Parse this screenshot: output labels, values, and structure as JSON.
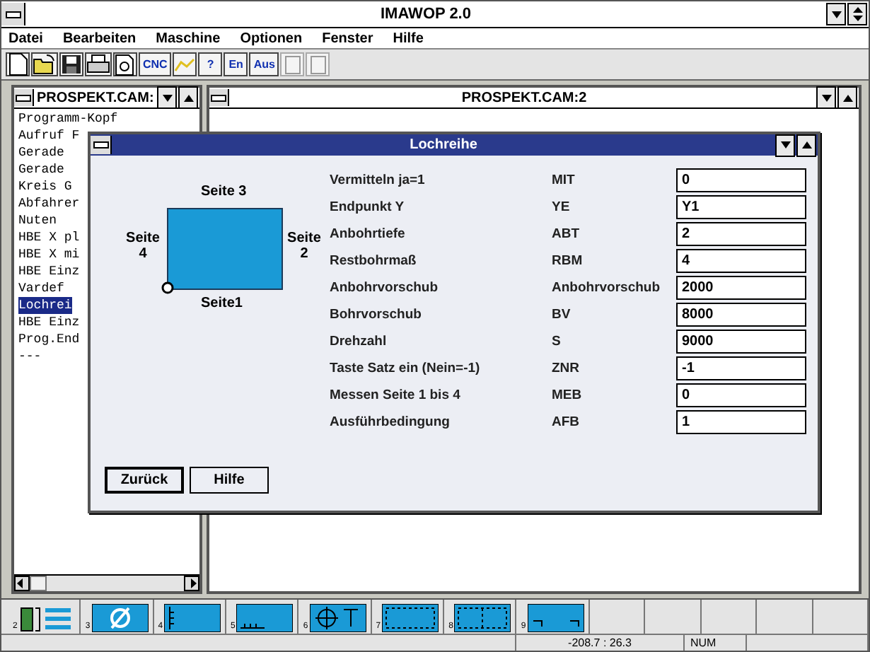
{
  "window": {
    "title": "IMAWOP 2.0"
  },
  "menu": [
    "Datei",
    "Bearbeiten",
    "Maschine",
    "Optionen",
    "Fenster",
    "Hilfe"
  ],
  "toolbar": [
    {
      "kind": "new"
    },
    {
      "kind": "open"
    },
    {
      "kind": "save"
    },
    {
      "kind": "print"
    },
    {
      "kind": "preview"
    },
    {
      "kind": "text",
      "label": "CNC"
    },
    {
      "kind": "chart"
    },
    {
      "kind": "text",
      "label": "?"
    },
    {
      "kind": "text",
      "label": "En"
    },
    {
      "kind": "text",
      "label": "Aus"
    },
    {
      "kind": "disabled"
    },
    {
      "kind": "disabled"
    }
  ],
  "left_window": {
    "title": "PROSPEKT.CAM:",
    "items": [
      {
        "text": "Programm-Kopf",
        "selected": false
      },
      {
        "text": "Aufruf F",
        "selected": false
      },
      {
        "text": "Gerade",
        "selected": false
      },
      {
        "text": "Gerade",
        "selected": false
      },
      {
        "text": "Kreis G",
        "selected": false
      },
      {
        "text": "Abfahrer",
        "selected": false
      },
      {
        "text": "Nuten",
        "selected": false
      },
      {
        "text": "HBE X pl",
        "selected": false
      },
      {
        "text": "HBE X mi",
        "selected": false
      },
      {
        "text": "HBE Einz",
        "selected": false
      },
      {
        "text": "Vardef",
        "selected": false
      },
      {
        "text": "Lochrei",
        "selected": true
      },
      {
        "text": "HBE Einz",
        "selected": false
      },
      {
        "text": "Prog.End",
        "selected": false
      },
      {
        "text": "---",
        "selected": false
      }
    ]
  },
  "right_window": {
    "title": "PROSPEKT.CAM:2"
  },
  "dialog": {
    "title": "Lochreihe",
    "diagram": {
      "top": "Seite 3",
      "left": "Seite 4",
      "right": "Seite 2",
      "bottom": "Seite1"
    },
    "fields": [
      {
        "label": "Vermitteln ja=1",
        "code": "MIT",
        "value": "0"
      },
      {
        "label": "Endpunkt Y",
        "code": "YE",
        "value": "Y1"
      },
      {
        "label": "Anbohrtiefe",
        "code": "ABT",
        "value": "2"
      },
      {
        "label": "Restbohrmaß",
        "code": "RBM",
        "value": "4"
      },
      {
        "label": "Anbohrvorschub",
        "code": "Anbohrvorschub",
        "value": "2000"
      },
      {
        "label": "Bohrvorschub",
        "code": "BV",
        "value": "8000"
      },
      {
        "label": "Drehzahl",
        "code": "S",
        "value": "9000"
      },
      {
        "label": "Taste Satz ein (Nein=-1)",
        "code": "ZNR",
        "value": "-1"
      },
      {
        "label": "Messen Seite 1 bis 4",
        "code": "MEB",
        "value": "0"
      },
      {
        "label": "Ausführbedingung",
        "code": "AFB",
        "value": "1"
      }
    ],
    "buttons": [
      "Zurück",
      "Hilfe"
    ]
  },
  "icon_bar": [
    {
      "kind": "exit",
      "number": "2"
    },
    {
      "kind": "slash",
      "number": "3"
    },
    {
      "kind": "left",
      "number": "4"
    },
    {
      "kind": "bottom",
      "number": "5"
    },
    {
      "kind": "cross",
      "number": "6"
    },
    {
      "kind": "frame",
      "number": "7"
    },
    {
      "kind": "grid",
      "number": "8"
    },
    {
      "kind": "corners",
      "number": "9"
    }
  ],
  "status_bar": {
    "coordinates": "-208.7 : 26.3",
    "num": "NUM"
  }
}
